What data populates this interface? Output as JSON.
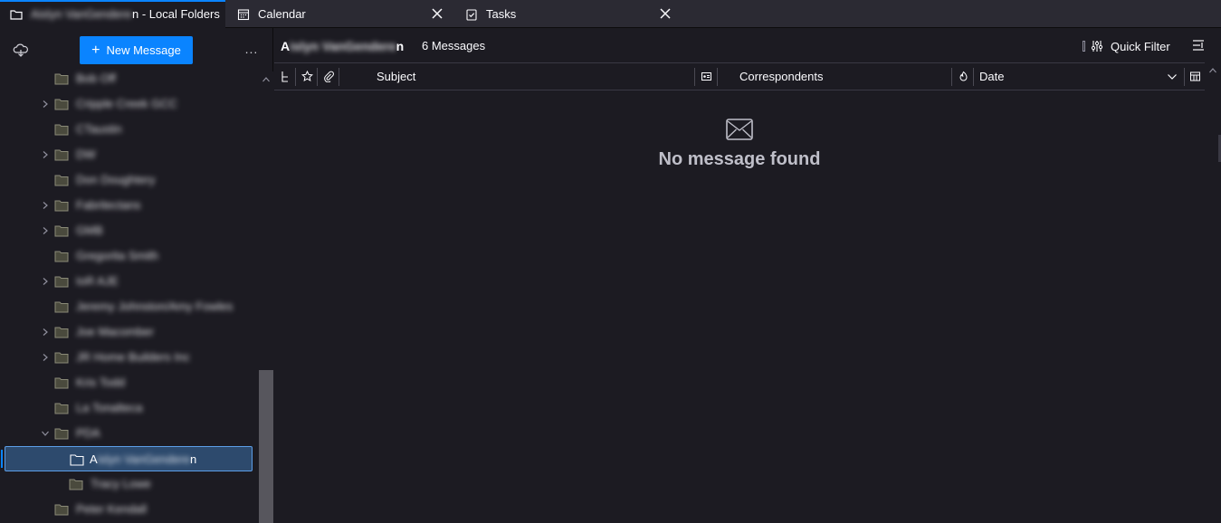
{
  "tabs": [
    {
      "label_blur": "Aislyn VanGenderen",
      "label_suffix": "n - Local Folders",
      "icon": "folder-icon",
      "active": true
    },
    {
      "label": "Calendar",
      "icon": "calendar-icon",
      "active": false
    },
    {
      "label": "Tasks",
      "icon": "tasks-icon",
      "active": false
    }
  ],
  "folder_pane": {
    "new_message_label": "New Message",
    "more_label": "...",
    "folders": [
      {
        "label": "Bob Off",
        "twisty": false
      },
      {
        "label": "Cripple Creek GCC",
        "twisty": true
      },
      {
        "label": "CTaustin",
        "twisty": false
      },
      {
        "label": "DW",
        "twisty": true
      },
      {
        "label": "Don Doughtery",
        "twisty": false
      },
      {
        "label": "Fabritectans",
        "twisty": true
      },
      {
        "label": "GMB",
        "twisty": true
      },
      {
        "label": "Gregorita Smith",
        "twisty": false
      },
      {
        "label": "IoR AJE",
        "twisty": true
      },
      {
        "label": "Jeremy Johnston/Amy Fowles",
        "twisty": false
      },
      {
        "label": "Joe Macomber",
        "twisty": true
      },
      {
        "label": "JR Home Builders Inc",
        "twisty": true
      },
      {
        "label": "Kris Todd",
        "twisty": false
      },
      {
        "label": "La Tonalteca",
        "twisty": false
      },
      {
        "label": "PDA",
        "twisty": true,
        "expanded": true
      },
      {
        "label_prefix": "A",
        "label": "islyn VanGendere",
        "label_suffix": "n",
        "selected": true,
        "child": true
      },
      {
        "label": "Tracy Lowe",
        "child": true
      },
      {
        "label": "Peter Kendall",
        "twisty": false
      }
    ]
  },
  "message_pane": {
    "folder_title_prefix": "A",
    "folder_title_blur": "islyn VanGendere",
    "folder_title_suffix": "n",
    "message_count": "6 Messages",
    "quick_filter_label": "Quick Filter",
    "columns": {
      "subject": "Subject",
      "correspondents": "Correspondents",
      "date": "Date"
    },
    "empty_text": "No message found"
  },
  "colors": {
    "accent": "#0a84ff",
    "background": "#1c1b22",
    "toolbar": "#2b2a33",
    "selection": "#2d4a6d"
  }
}
